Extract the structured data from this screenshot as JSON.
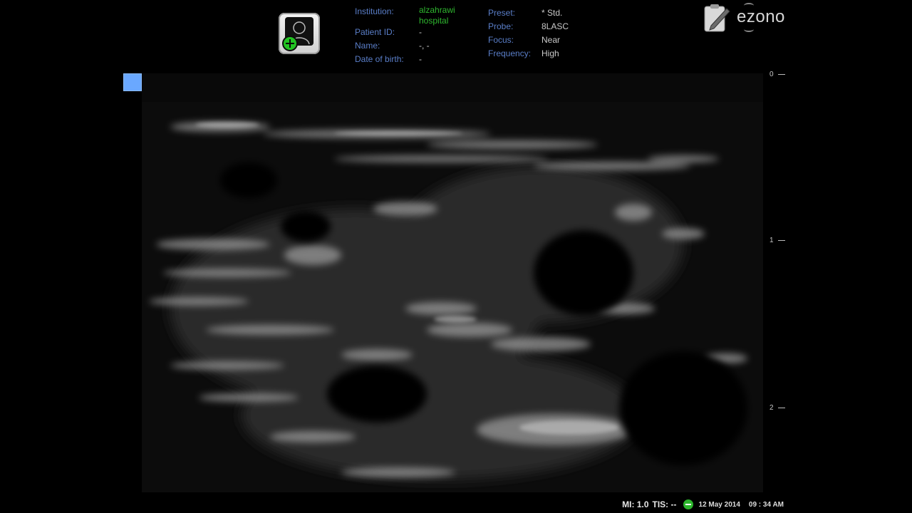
{
  "patient_info": {
    "institution_label": "Institution:",
    "institution_value": "alzahrawi hospital",
    "patient_id_label": "Patient ID:",
    "patient_id_value": "-",
    "name_label": "Name:",
    "name_value": "-, -",
    "dob_label": "Date of birth:",
    "dob_value": "-"
  },
  "scan_settings": {
    "preset_label": "Preset:",
    "preset_value": "* Std.",
    "probe_label": "Probe:",
    "probe_value": "8LASC",
    "focus_label": "Focus:",
    "focus_value": "Near",
    "frequency_label": "Frequency:",
    "frequency_value": "High"
  },
  "brand": "ezono",
  "depth_scale": [
    "0",
    "1",
    "2"
  ],
  "status_bar": {
    "mi": "MI: 1.0",
    "tis": "TIS: --",
    "date": "12 May 2014",
    "time": "09 : 34 AM"
  },
  "colors": {
    "label_blue": "#5a7ec8",
    "institution_green": "#2fb72f",
    "orientation_marker": "#6aa8ff"
  },
  "icons": {
    "patient_button": "patient-add-icon",
    "report": "clipboard-pen-icon",
    "status": "battery-ok-icon"
  }
}
